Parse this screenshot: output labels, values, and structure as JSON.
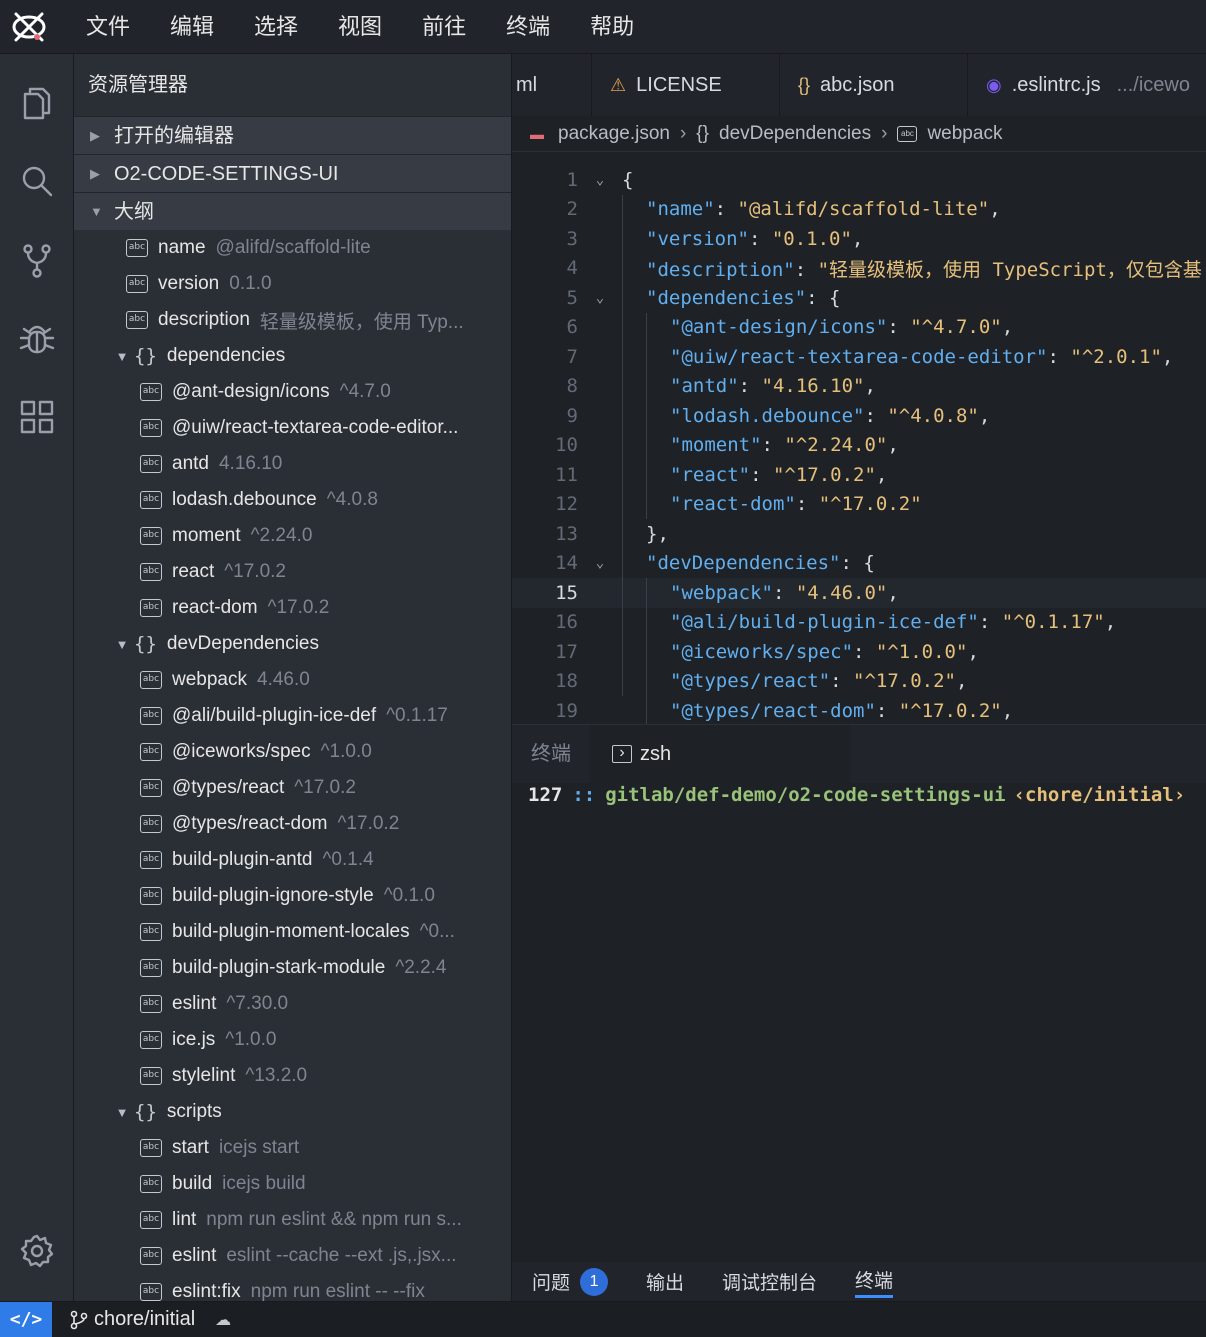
{
  "menubar": {
    "items": [
      "文件",
      "编辑",
      "选择",
      "视图",
      "前往",
      "终端",
      "帮助"
    ]
  },
  "activity": [
    "files-icon",
    "search-icon",
    "source-control-icon",
    "debug-icon",
    "extensions-icon",
    "settings-icon"
  ],
  "sidebar": {
    "title": "资源管理器",
    "sections": {
      "open_editors": "打开的编辑器",
      "project": "O2-CODE-SETTINGS-UI",
      "outline": "大纲"
    },
    "outline": [
      {
        "level": 1,
        "type": "abc",
        "key": "name",
        "value": "@alifd/scaffold-lite"
      },
      {
        "level": 1,
        "type": "abc",
        "key": "version",
        "value": "0.1.0"
      },
      {
        "level": 1,
        "type": "abc",
        "key": "description",
        "value": "轻量级模板，使用 Typ..."
      },
      {
        "level": 1,
        "type": "obj",
        "key": "dependencies",
        "value": ""
      },
      {
        "level": 2,
        "type": "abc",
        "key": "@ant-design/icons",
        "value": "^4.7.0"
      },
      {
        "level": 2,
        "type": "abc",
        "key": "@uiw/react-textarea-code-editor...",
        "value": ""
      },
      {
        "level": 2,
        "type": "abc",
        "key": "antd",
        "value": "4.16.10"
      },
      {
        "level": 2,
        "type": "abc",
        "key": "lodash.debounce",
        "value": "^4.0.8"
      },
      {
        "level": 2,
        "type": "abc",
        "key": "moment",
        "value": "^2.24.0"
      },
      {
        "level": 2,
        "type": "abc",
        "key": "react",
        "value": "^17.0.2"
      },
      {
        "level": 2,
        "type": "abc",
        "key": "react-dom",
        "value": "^17.0.2"
      },
      {
        "level": 1,
        "type": "obj",
        "key": "devDependencies",
        "value": ""
      },
      {
        "level": 2,
        "type": "abc",
        "key": "webpack",
        "value": "4.46.0"
      },
      {
        "level": 2,
        "type": "abc",
        "key": "@ali/build-plugin-ice-def",
        "value": "^0.1.17"
      },
      {
        "level": 2,
        "type": "abc",
        "key": "@iceworks/spec",
        "value": "^1.0.0"
      },
      {
        "level": 2,
        "type": "abc",
        "key": "@types/react",
        "value": "^17.0.2"
      },
      {
        "level": 2,
        "type": "abc",
        "key": "@types/react-dom",
        "value": "^17.0.2"
      },
      {
        "level": 2,
        "type": "abc",
        "key": "build-plugin-antd",
        "value": "^0.1.4"
      },
      {
        "level": 2,
        "type": "abc",
        "key": "build-plugin-ignore-style",
        "value": "^0.1.0"
      },
      {
        "level": 2,
        "type": "abc",
        "key": "build-plugin-moment-locales",
        "value": "^0..."
      },
      {
        "level": 2,
        "type": "abc",
        "key": "build-plugin-stark-module",
        "value": "^2.2.4"
      },
      {
        "level": 2,
        "type": "abc",
        "key": "eslint",
        "value": "^7.30.0"
      },
      {
        "level": 2,
        "type": "abc",
        "key": "ice.js",
        "value": "^1.0.0"
      },
      {
        "level": 2,
        "type": "abc",
        "key": "stylelint",
        "value": "^13.2.0"
      },
      {
        "level": 1,
        "type": "obj",
        "key": "scripts",
        "value": ""
      },
      {
        "level": 2,
        "type": "abc",
        "key": "start",
        "value": "icejs start"
      },
      {
        "level": 2,
        "type": "abc",
        "key": "build",
        "value": "icejs build"
      },
      {
        "level": 2,
        "type": "abc",
        "key": "lint",
        "value": "npm run eslint && npm run s..."
      },
      {
        "level": 2,
        "type": "abc",
        "key": "eslint",
        "value": "eslint --cache --ext .js,.jsx..."
      },
      {
        "level": 2,
        "type": "abc",
        "key": "eslint:fix",
        "value": "npm run eslint -- --fix"
      }
    ]
  },
  "tabs": [
    {
      "label": "ml",
      "icon": "",
      "hint": ""
    },
    {
      "label": "LICENSE",
      "icon": "license-icon",
      "hint": ""
    },
    {
      "label": "abc.json",
      "icon": "json-icon",
      "hint": ""
    },
    {
      "label": ".eslintrc.js",
      "icon": "eslint-icon",
      "hint": ".../icewo"
    }
  ],
  "breadcrumb": {
    "file": "package.json",
    "object": "devDependencies",
    "leaf": "webpack"
  },
  "editor": {
    "current_line": 15,
    "lines": [
      {
        "n": "1",
        "fold": "v",
        "indent": 0,
        "parts": [
          [
            "p",
            "{"
          ]
        ]
      },
      {
        "n": "2",
        "fold": "",
        "indent": 1,
        "parts": [
          [
            "k",
            "\"name\""
          ],
          [
            "p",
            ": "
          ],
          [
            "s",
            "\"@alifd/scaffold-lite\""
          ],
          [
            "p",
            ","
          ]
        ]
      },
      {
        "n": "3",
        "fold": "",
        "indent": 1,
        "parts": [
          [
            "k",
            "\"version\""
          ],
          [
            "p",
            ": "
          ],
          [
            "s",
            "\"0.1.0\""
          ],
          [
            "p",
            ","
          ]
        ]
      },
      {
        "n": "4",
        "fold": "",
        "indent": 1,
        "parts": [
          [
            "k",
            "\"description\""
          ],
          [
            "p",
            ": "
          ],
          [
            "s",
            "\"轻量级模板，使用 TypeScript，仅包含基"
          ]
        ]
      },
      {
        "n": "5",
        "fold": "v",
        "indent": 1,
        "parts": [
          [
            "k",
            "\"dependencies\""
          ],
          [
            "p",
            ": {"
          ]
        ]
      },
      {
        "n": "6",
        "fold": "",
        "indent": 2,
        "parts": [
          [
            "k",
            "\"@ant-design/icons\""
          ],
          [
            "p",
            ": "
          ],
          [
            "s",
            "\"^4.7.0\""
          ],
          [
            "p",
            ","
          ]
        ]
      },
      {
        "n": "7",
        "fold": "",
        "indent": 2,
        "parts": [
          [
            "k",
            "\"@uiw/react-textarea-code-editor\""
          ],
          [
            "p",
            ": "
          ],
          [
            "s",
            "\"^2.0.1\""
          ],
          [
            "p",
            ","
          ]
        ]
      },
      {
        "n": "8",
        "fold": "",
        "indent": 2,
        "parts": [
          [
            "k",
            "\"antd\""
          ],
          [
            "p",
            ": "
          ],
          [
            "s",
            "\"4.16.10\""
          ],
          [
            "p",
            ","
          ]
        ]
      },
      {
        "n": "9",
        "fold": "",
        "indent": 2,
        "parts": [
          [
            "k",
            "\"lodash.debounce\""
          ],
          [
            "p",
            ": "
          ],
          [
            "s",
            "\"^4.0.8\""
          ],
          [
            "p",
            ","
          ]
        ]
      },
      {
        "n": "10",
        "fold": "",
        "indent": 2,
        "parts": [
          [
            "k",
            "\"moment\""
          ],
          [
            "p",
            ": "
          ],
          [
            "s",
            "\"^2.24.0\""
          ],
          [
            "p",
            ","
          ]
        ]
      },
      {
        "n": "11",
        "fold": "",
        "indent": 2,
        "parts": [
          [
            "k",
            "\"react\""
          ],
          [
            "p",
            ": "
          ],
          [
            "s",
            "\"^17.0.2\""
          ],
          [
            "p",
            ","
          ]
        ]
      },
      {
        "n": "12",
        "fold": "",
        "indent": 2,
        "parts": [
          [
            "k",
            "\"react-dom\""
          ],
          [
            "p",
            ": "
          ],
          [
            "s",
            "\"^17.0.2\""
          ]
        ]
      },
      {
        "n": "13",
        "fold": "",
        "indent": 1,
        "parts": [
          [
            "p",
            "},"
          ]
        ]
      },
      {
        "n": "14",
        "fold": "v",
        "indent": 1,
        "parts": [
          [
            "k",
            "\"devDependencies\""
          ],
          [
            "p",
            ": {"
          ]
        ]
      },
      {
        "n": "15",
        "fold": "",
        "indent": 2,
        "parts": [
          [
            "k",
            "\"webpack\""
          ],
          [
            "p",
            ": "
          ],
          [
            "s",
            "\"4.46.0\""
          ],
          [
            "p",
            ","
          ]
        ]
      },
      {
        "n": "16",
        "fold": "",
        "indent": 2,
        "parts": [
          [
            "k",
            "\"@ali/build-plugin-ice-def\""
          ],
          [
            "p",
            ": "
          ],
          [
            "s",
            "\"^0.1.17\""
          ],
          [
            "p",
            ","
          ]
        ]
      },
      {
        "n": "17",
        "fold": "",
        "indent": 2,
        "parts": [
          [
            "k",
            "\"@iceworks/spec\""
          ],
          [
            "p",
            ": "
          ],
          [
            "s",
            "\"^1.0.0\""
          ],
          [
            "p",
            ","
          ]
        ]
      },
      {
        "n": "18",
        "fold": "",
        "indent": 2,
        "parts": [
          [
            "k",
            "\"@types/react\""
          ],
          [
            "p",
            ": "
          ],
          [
            "s",
            "\"^17.0.2\""
          ],
          [
            "p",
            ","
          ]
        ]
      },
      {
        "n": "19",
        "fold": "",
        "indent": 2,
        "parts": [
          [
            "k",
            "\"@types/react-dom\""
          ],
          [
            "p",
            ": "
          ],
          [
            "s",
            "\"^17.0.2\""
          ],
          [
            "p",
            ","
          ]
        ]
      }
    ]
  },
  "panel": {
    "inactive_tab": "终端",
    "active_tab": "zsh",
    "terminal": {
      "number": "127",
      "sep": "::",
      "path": "gitlab/def-demo/o2-code-settings-ui",
      "branch": "‹chore/initial›"
    },
    "bottom_tabs": [
      {
        "label": "问题",
        "badge": "1",
        "active": false
      },
      {
        "label": "输出",
        "badge": "",
        "active": false
      },
      {
        "label": "调试控制台",
        "badge": "",
        "active": false
      },
      {
        "label": "终端",
        "badge": "",
        "active": true
      }
    ]
  },
  "statusbar": {
    "remote": "</>",
    "branch": "chore/initial"
  },
  "colors": {
    "accent": "#2f7be8",
    "badge": "#2f6ed8",
    "json_key": "#61afef",
    "json_string": "#e5c07b",
    "terminal_path": "#98c379"
  }
}
